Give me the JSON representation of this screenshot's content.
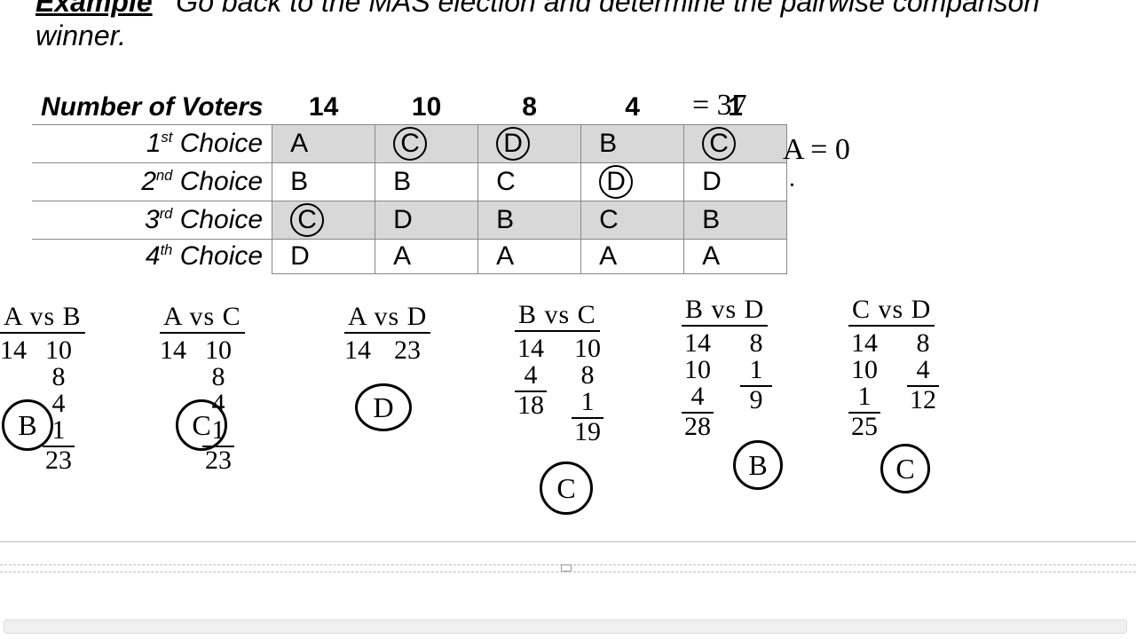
{
  "header": {
    "example_label": "Example",
    "line1_right": "Go back to the MAS election and determine the pairwise comparison",
    "line2": "winner."
  },
  "table": {
    "row_header": "Number of Voters",
    "columns": [
      "14",
      "10",
      "8",
      "4",
      "1"
    ],
    "rows": [
      {
        "rank": "1",
        "suffix": "st",
        "label": "Choice",
        "cells": [
          "A",
          "C",
          "D",
          "B",
          "C"
        ],
        "circled": [
          false,
          true,
          true,
          false,
          true
        ]
      },
      {
        "rank": "2",
        "suffix": "nd",
        "label": "Choice",
        "cells": [
          "B",
          "B",
          "C",
          "D",
          "D"
        ],
        "circled": [
          false,
          false,
          false,
          true,
          false
        ]
      },
      {
        "rank": "3",
        "suffix": "rd",
        "label": "Choice",
        "cells": [
          "C",
          "D",
          "B",
          "C",
          "B"
        ],
        "circled": [
          true,
          false,
          false,
          false,
          false
        ]
      },
      {
        "rank": "4",
        "suffix": "th",
        "label": "Choice",
        "cells": [
          "D",
          "A",
          "A",
          "A",
          "A"
        ],
        "circled": [
          false,
          false,
          false,
          false,
          false
        ]
      }
    ]
  },
  "annotations": {
    "total_equals": "= 37",
    "a_equals_zero": "A = 0"
  },
  "pairs": {
    "ab": {
      "title": "A vs B",
      "left": [
        "14"
      ],
      "right": [
        "10",
        "8",
        "4",
        "1"
      ],
      "right_sum": "23",
      "winner": "B"
    },
    "ac": {
      "title": "A vs C",
      "left": [
        "14"
      ],
      "right": [
        "10",
        "8",
        "4",
        "1"
      ],
      "right_sum": "23",
      "winner": "C"
    },
    "ad": {
      "title": "A vs D",
      "left": [
        "14"
      ],
      "right_single": "23",
      "winner": "D"
    },
    "bc": {
      "title": "B vs C",
      "left": [
        "14",
        "4"
      ],
      "left_sum": "18",
      "right": [
        "10",
        "8",
        "1"
      ],
      "right_sum": "19",
      "winner": "C"
    },
    "bd": {
      "title": "B vs D",
      "left": [
        "14",
        "10",
        "4"
      ],
      "left_sum": "28",
      "right": [
        "8",
        "1"
      ],
      "right_sum": "9",
      "winner": "B"
    },
    "cd": {
      "title": "C vs D",
      "left": [
        "14",
        "10",
        "1"
      ],
      "left_sum": "25",
      "right": [
        "8",
        "4"
      ],
      "right_sum": "12",
      "winner": "C"
    }
  }
}
